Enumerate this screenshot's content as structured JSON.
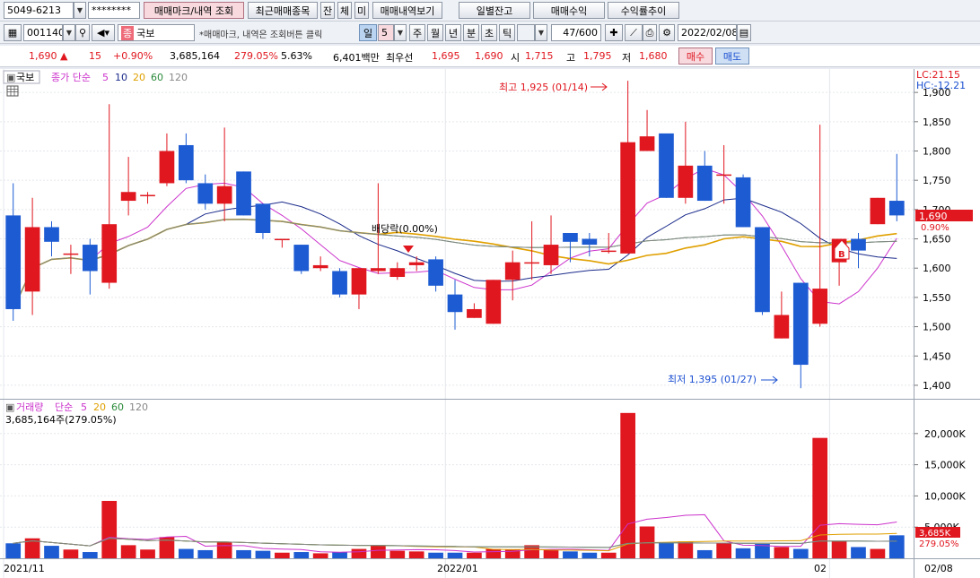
{
  "toolbar": {
    "account": "5049-6213",
    "password": "********",
    "trade_marks_btn": "매매마크/내역 조회",
    "recent_btn": "최근매매종목",
    "btn_jan": "잔",
    "btn_che": "체",
    "btn_mi": "미",
    "history_btn": "매매내역보기",
    "daily_balance_btn": "일별잔고",
    "trade_profit_btn": "매매수익",
    "return_trend_btn": "수익률추이"
  },
  "toolbar2": {
    "code": "001140",
    "market_tag": "종",
    "stock_name": "국보",
    "hint": "*매매마크, 내역은 조회버튼 클릭",
    "period_day": "일",
    "period_num": "5",
    "period_week": "주",
    "period_month": "월",
    "period_year": "년",
    "period_min": "분",
    "period_sec": "초",
    "period_tick": "틱",
    "count": "47/600",
    "date": "2022/02/08"
  },
  "quote": {
    "price": "1,690",
    "arrow": "▲",
    "change": "15",
    "change_pct": "+0.90%",
    "volume": "3,685,164",
    "vol_ratio": "279.05%",
    "turnover": "5.63%",
    "amount": "6,401백만",
    "best_label": "최우선",
    "best_ask": "1,695",
    "best_bid": "1,690",
    "open_label": "시",
    "open": "1,715",
    "high_label": "고",
    "high": "1,795",
    "low_label": "저",
    "low": "1,680",
    "buy_btn": "매수",
    "sell_btn": "매도"
  },
  "price_panel": {
    "tab": "국보",
    "legend_main": "종가 단순",
    "ma": [
      "5",
      "10",
      "20",
      "60",
      "120"
    ],
    "lc": "LC:21.15",
    "hc": "HC:-12.21",
    "high_annot": "최고 1,925 (01/14)",
    "low_annot": "최저 1,395 (01/27)",
    "dividend_annot": "배당락(0.00%)",
    "buy_mark": "B",
    "last_price_tag": "1,690",
    "last_pct_tag": "0.90%",
    "y_ticks": [
      "1,900",
      "1,850",
      "1,800",
      "1,750",
      "1,700",
      "1,650",
      "1,600",
      "1,550",
      "1,500",
      "1,450",
      "1,400"
    ]
  },
  "volume_panel": {
    "title": "거래량",
    "legend_main": "단순",
    "ma": [
      "5",
      "20",
      "60",
      "120"
    ],
    "info": "3,685,164주(279.05%)",
    "y_ticks": [
      "20,000K",
      "15,000K",
      "10,000K",
      "5,000K"
    ],
    "last_vol_tag": "3,685K",
    "last_pct_tag": "279.05%"
  },
  "x_axis": {
    "labels": [
      "2021/11",
      "2022/01",
      "02"
    ],
    "right_label": "02/08"
  },
  "colors": {
    "up": "#e0171f",
    "down": "#1d5bd3",
    "ma5": "#cc33cc",
    "ma10": "#1a2a8a",
    "ma20": "#e0a000",
    "ma60": "#2a8a3a",
    "ma120": "#888888"
  },
  "chart_data": {
    "type": "candlestick",
    "x": [
      "2021/11",
      "2022/01",
      "02"
    ],
    "candles": [
      {
        "o": 1690,
        "h": 1745,
        "l": 1510,
        "c": 1530
      },
      {
        "o": 1560,
        "h": 1720,
        "l": 1520,
        "c": 1670
      },
      {
        "o": 1670,
        "h": 1680,
        "l": 1620,
        "c": 1645
      },
      {
        "o": 1625,
        "h": 1640,
        "l": 1590,
        "c": 1625
      },
      {
        "o": 1640,
        "h": 1650,
        "l": 1555,
        "c": 1595
      },
      {
        "o": 1575,
        "h": 1880,
        "l": 1565,
        "c": 1675
      },
      {
        "o": 1715,
        "h": 1790,
        "l": 1690,
        "c": 1730
      },
      {
        "o": 1725,
        "h": 1730,
        "l": 1710,
        "c": 1725
      },
      {
        "o": 1745,
        "h": 1830,
        "l": 1740,
        "c": 1800
      },
      {
        "o": 1810,
        "h": 1830,
        "l": 1745,
        "c": 1750
      },
      {
        "o": 1745,
        "h": 1760,
        "l": 1700,
        "c": 1710
      },
      {
        "o": 1710,
        "h": 1840,
        "l": 1680,
        "c": 1740
      },
      {
        "o": 1765,
        "h": 1765,
        "l": 1690,
        "c": 1690
      },
      {
        "o": 1710,
        "h": 1710,
        "l": 1650,
        "c": 1660
      },
      {
        "o": 1650,
        "h": 1650,
        "l": 1635,
        "c": 1650
      },
      {
        "o": 1640,
        "h": 1640,
        "l": 1590,
        "c": 1595
      },
      {
        "o": 1600,
        "h": 1620,
        "l": 1595,
        "c": 1605
      },
      {
        "o": 1595,
        "h": 1600,
        "l": 1550,
        "c": 1555
      },
      {
        "o": 1555,
        "h": 1600,
        "l": 1530,
        "c": 1600
      },
      {
        "o": 1595,
        "h": 1745,
        "l": 1590,
        "c": 1600
      },
      {
        "o": 1585,
        "h": 1610,
        "l": 1580,
        "c": 1600
      },
      {
        "o": 1605,
        "h": 1620,
        "l": 1595,
        "c": 1610
      },
      {
        "o": 1615,
        "h": 1620,
        "l": 1560,
        "c": 1570
      },
      {
        "o": 1555,
        "h": 1580,
        "l": 1495,
        "c": 1525
      },
      {
        "o": 1515,
        "h": 1540,
        "l": 1515,
        "c": 1530
      },
      {
        "o": 1505,
        "h": 1580,
        "l": 1505,
        "c": 1580
      },
      {
        "o": 1580,
        "h": 1630,
        "l": 1545,
        "c": 1610
      },
      {
        "o": 1610,
        "h": 1680,
        "l": 1580,
        "c": 1610
      },
      {
        "o": 1605,
        "h": 1690,
        "l": 1590,
        "c": 1640
      },
      {
        "o": 1660,
        "h": 1660,
        "l": 1610,
        "c": 1645
      },
      {
        "o": 1650,
        "h": 1660,
        "l": 1620,
        "c": 1640
      },
      {
        "o": 1630,
        "h": 1660,
        "l": 1625,
        "c": 1630
      },
      {
        "o": 1625,
        "h": 1920,
        "l": 1625,
        "c": 1815
      },
      {
        "o": 1800,
        "h": 1870,
        "l": 1800,
        "c": 1825
      },
      {
        "o": 1830,
        "h": 1825,
        "l": 1720,
        "c": 1720
      },
      {
        "o": 1720,
        "h": 1850,
        "l": 1710,
        "c": 1775
      },
      {
        "o": 1775,
        "h": 1800,
        "l": 1715,
        "c": 1715
      },
      {
        "o": 1760,
        "h": 1810,
        "l": 1710,
        "c": 1760
      },
      {
        "o": 1755,
        "h": 1760,
        "l": 1670,
        "c": 1670
      },
      {
        "o": 1670,
        "h": 1670,
        "l": 1520,
        "c": 1525
      },
      {
        "o": 1480,
        "h": 1560,
        "l": 1480,
        "c": 1520
      },
      {
        "o": 1575,
        "h": 1575,
        "l": 1395,
        "c": 1435
      },
      {
        "o": 1505,
        "h": 1845,
        "l": 1500,
        "c": 1565
      },
      {
        "o": 1610,
        "h": 1650,
        "l": 1570,
        "c": 1650
      },
      {
        "o": 1650,
        "h": 1660,
        "l": 1600,
        "c": 1630
      },
      {
        "o": 1675,
        "h": 1720,
        "l": 1675,
        "c": 1720
      },
      {
        "o": 1715,
        "h": 1795,
        "l": 1680,
        "c": 1690
      }
    ],
    "volume_k": [
      2400,
      3200,
      2000,
      1400,
      1000,
      9200,
      2100,
      1400,
      3400,
      1500,
      1300,
      2600,
      1300,
      1200,
      900,
      1000,
      800,
      1000,
      1500,
      2100,
      1200,
      1100,
      900,
      900,
      900,
      1500,
      1400,
      2100,
      1300,
      1100,
      900,
      900,
      23300,
      5100,
      2500,
      2700,
      1300,
      2400,
      1600,
      2300,
      1800,
      1500,
      19300,
      2800,
      1800,
      1500,
      3685
    ],
    "ylim_price": [
      1380,
      1940
    ],
    "ylim_volume": [
      0,
      25000
    ]
  }
}
